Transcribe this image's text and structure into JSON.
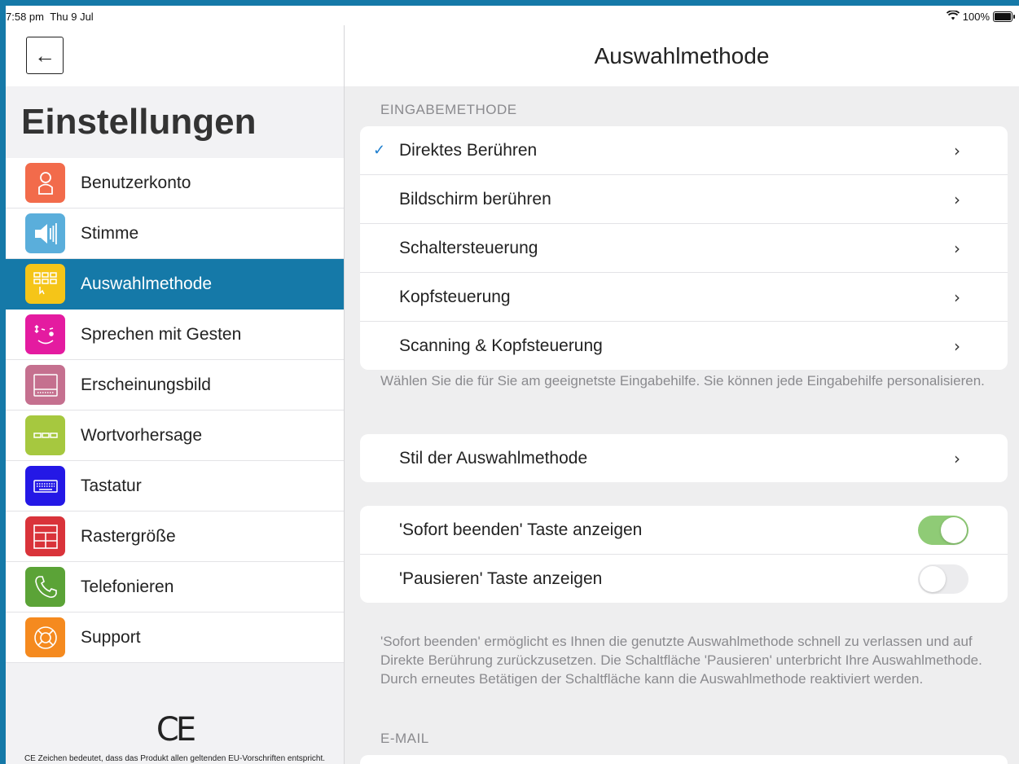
{
  "status_bar": {
    "time": "7:58 pm",
    "date": "Thu 9 Jul",
    "battery": "100%",
    "wifi_icon": "wifi-icon"
  },
  "sidebar": {
    "back_icon": "arrow-left-icon",
    "title": "Einstellungen",
    "items": [
      {
        "label": "Benutzerkonto",
        "icon": "user-icon",
        "color": "#f26b4b"
      },
      {
        "label": "Stimme",
        "icon": "speaker-icon",
        "color": "#5aaedb"
      },
      {
        "label": "Auswahlmethode",
        "icon": "grid-select-icon",
        "color": "#f5c518",
        "active": true
      },
      {
        "label": "Sprechen mit Gesten",
        "icon": "wink-face-icon",
        "color": "#e41ba0"
      },
      {
        "label": "Erscheinungsbild",
        "icon": "screen-keyboard-icon",
        "color": "#c5708f"
      },
      {
        "label": "Wortvorhersage",
        "icon": "word-boxes-icon",
        "color": "#a6c83f"
      },
      {
        "label": "Tastatur",
        "icon": "keyboard-icon",
        "color": "#2418e6"
      },
      {
        "label": "Rastergröße",
        "icon": "grid-size-icon",
        "color": "#d9333a"
      },
      {
        "label": "Telefonieren",
        "icon": "phone-icon",
        "color": "#5ba337"
      },
      {
        "label": "Support",
        "icon": "lifebuoy-icon",
        "color": "#f58a1f"
      }
    ],
    "ce_mark": "CE",
    "ce_text": "CE Zeichen bedeutet, dass das Produkt allen geltenden EU-Vorschriften entspricht."
  },
  "main": {
    "title": "Auswahlmethode",
    "input_section": {
      "header": "EINGABEMETHODE",
      "rows": [
        {
          "label": "Direktes Berühren",
          "selected": true
        },
        {
          "label": "Bildschirm berühren",
          "selected": false
        },
        {
          "label": "Schaltersteuerung",
          "selected": false
        },
        {
          "label": "Kopfsteuerung",
          "selected": false
        },
        {
          "label": "Scanning & Kopfsteuerung",
          "selected": false
        }
      ],
      "footnote": "Wählen Sie die für Sie am geeignetste Eingabehilfe. Sie können jede Eingabehilfe personalisieren."
    },
    "style_row": {
      "label": "Stil der Auswahlmethode"
    },
    "toggles": [
      {
        "label": "'Sofort beenden' Taste anzeigen",
        "on": true
      },
      {
        "label": "'Pausieren' Taste anzeigen",
        "on": false
      }
    ],
    "toggles_footnote": "'Sofort beenden' ermöglicht es Ihnen die genutzte Auswahlmethode schnell zu verlassen und auf Direkte Berührung zurückzusetzen. Die Schaltfläche 'Pausieren' unterbricht Ihre Auswahlmethode. Durch erneutes Betätigen der Schaltfläche kann die Auswahlmethode reaktiviert werden.",
    "email_header": "E-MAIL",
    "check_glyph": "✓",
    "chevron_glyph": "›"
  }
}
